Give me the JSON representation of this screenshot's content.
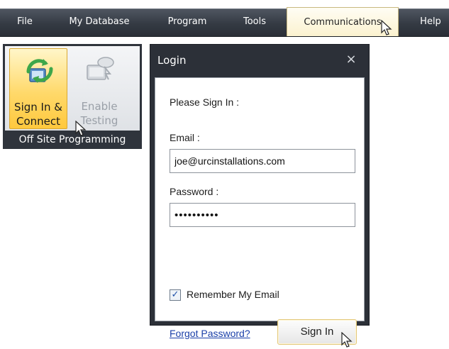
{
  "menu": {
    "items": [
      "File",
      "My Database",
      "Program",
      "Tools",
      "Communications",
      "Help"
    ],
    "active": "Communications"
  },
  "ribbon": {
    "sign_in_line1": "Sign In &",
    "sign_in_line2": "Connect",
    "enable_line1": "Enable",
    "enable_line2": "Testing",
    "group_label": "Off Site Programming",
    "highlight_color": "#ffd96b"
  },
  "dialog": {
    "title": "Login",
    "close_glyph": "×",
    "prompt": "Please Sign In :",
    "email_label": "Email :",
    "email_value": "joe@urcinstallations.com",
    "password_label": "Password :",
    "password_value": "••••••••••",
    "remember_label": "Remember My Email",
    "remember_checked": "✓",
    "forgot_link": "Forgot Password?",
    "sign_in_button": "Sign In"
  },
  "icons": {
    "sign_in": "cloud-connect-icon",
    "enable_testing": "cloud-test-icon",
    "cursor": "mouse-pointer-icon"
  }
}
